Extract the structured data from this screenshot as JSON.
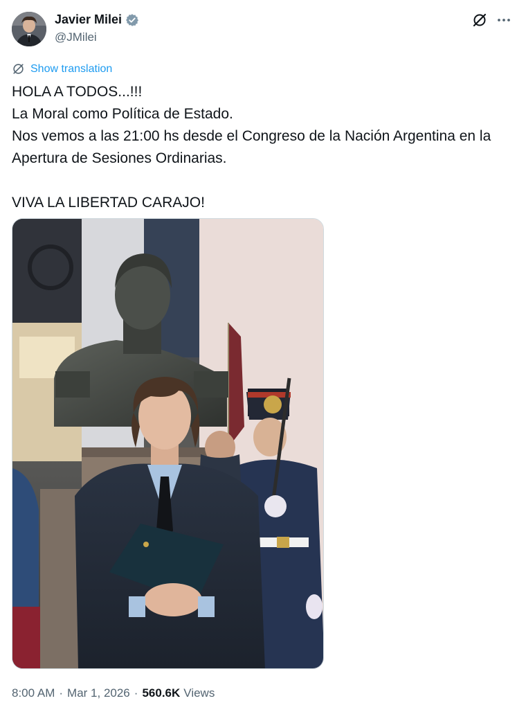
{
  "author": {
    "display_name": "Javier Milei",
    "handle": "@JMilei",
    "verified": true,
    "verified_color": "#1d9bf0"
  },
  "header_icons": [
    "grok-icon",
    "more-icon"
  ],
  "translation": {
    "label": "Show translation",
    "icon": "translate-globe-icon",
    "color": "#1d9bf0"
  },
  "tweet": {
    "lines": [
      "HOLA A TODOS...!!!",
      "La Moral como Política de Estado.",
      "Nos vemos a las 21:00 hs desde el Congreso de la Nación Argentina en la Apertura de Sesiones Ordinarias.",
      "VIVA LA LIBERTAD CARAJO!"
    ]
  },
  "meta": {
    "time": "8:00 AM",
    "separator": "·",
    "date": "Mar 1, 2026",
    "views_count": "560.6K",
    "views_label": "Views"
  }
}
